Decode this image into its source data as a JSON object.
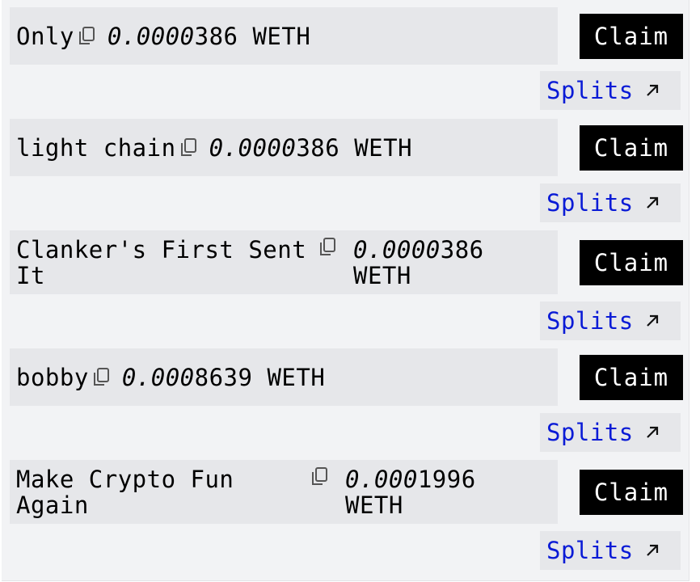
{
  "claims": [
    {
      "name": "Only",
      "amount_prefix": "0.0000",
      "amount_digits": "386",
      "token": "WETH",
      "claim_label": "Claim",
      "splits_label": "Splits"
    },
    {
      "name": "light chain",
      "amount_prefix": "0.0000",
      "amount_digits": "386",
      "token": "WETH",
      "claim_label": "Claim",
      "splits_label": "Splits"
    },
    {
      "name": "Clanker's First Sent It",
      "amount_prefix": "0.0000",
      "amount_digits": "386",
      "token": "WETH",
      "claim_label": "Claim",
      "splits_label": "Splits"
    },
    {
      "name": "bobby",
      "amount_prefix": "0.000",
      "amount_digits": "8639",
      "token": "WETH",
      "claim_label": "Claim",
      "splits_label": "Splits"
    },
    {
      "name": "Make Crypto Fun Again",
      "amount_prefix": "0.000",
      "amount_digits": "1996",
      "token": "WETH",
      "claim_label": "Claim",
      "splits_label": "Splits"
    }
  ],
  "icons": {
    "copy": "copy-icon",
    "splits_arrow": "arrow-up-right-icon"
  },
  "colors": {
    "link": "#0a1bd6",
    "button_bg": "#000000",
    "row_bg": "#e6e7ea",
    "panel_bg": "#f2f3f5"
  }
}
